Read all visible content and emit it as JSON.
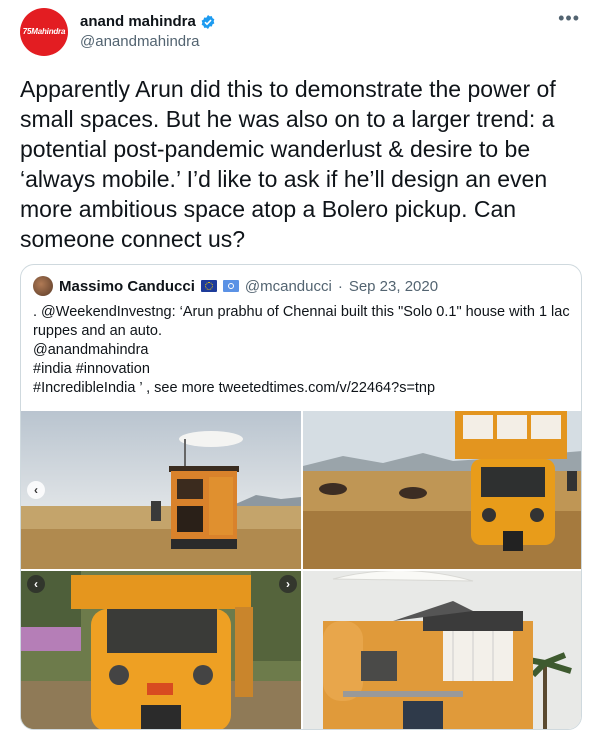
{
  "author": {
    "name": "anand mahindra",
    "handle": "@anandmahindra",
    "avatar_logo": "Mahindra",
    "avatar_logo_prefix": "75"
  },
  "tweet": {
    "text": "Apparently Arun did this to demonstrate the power of small spaces. But he was also on to a larger trend: a potential post-pandemic wanderlust & desire to be ‘always mobile.’ I’d like to ask if he’ll design an even more ambitious space atop a Bolero pickup. Can someone connect us?"
  },
  "more_icon": "more-horizontal-icon",
  "quote": {
    "name": "Massimo Canducci",
    "handle": "@mcanducci",
    "separator": "·",
    "date": "Sep 23, 2020",
    "text": ". @WeekendInvestng: ‘Arun prabhu of Chennai built this \"Solo 0.1\" house with 1 lac ruppes and an auto.\n@anandmahindra\n#india #innovation\n#IncredibleIndia ’ , see more tweetedtimes.com/v/22464?s=tnp"
  },
  "colors": {
    "verified": "#1d9bf0",
    "brand_red": "#e31d22",
    "muted": "#536471",
    "auto_orange": "#e5961e"
  },
  "nav": {
    "prev": "‹",
    "next": "›"
  }
}
